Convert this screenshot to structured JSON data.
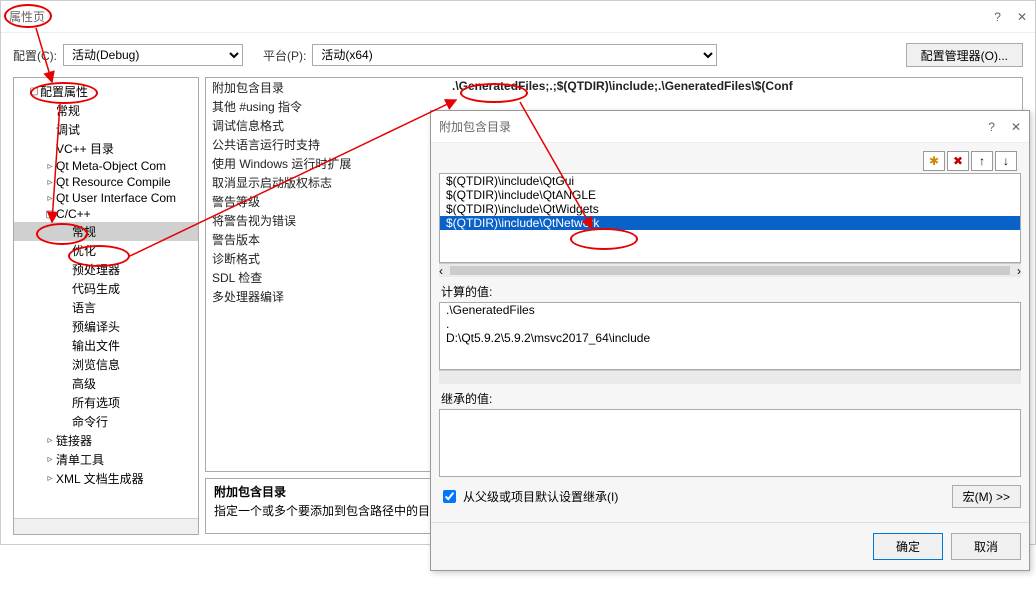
{
  "main": {
    "title": "属性页",
    "help": "?",
    "close": "✕",
    "config_label": "配置(C):",
    "config_value": "活动(Debug)",
    "platform_label": "平台(P):",
    "platform_value": "活动(x64)",
    "config_mgr": "配置管理器(O)..."
  },
  "tree": [
    {
      "label": "配置属性",
      "arrow": "▢",
      "ind": 1
    },
    {
      "label": "常规",
      "arrow": "",
      "ind": 2
    },
    {
      "label": "调试",
      "arrow": "",
      "ind": 2
    },
    {
      "label": "VC++ 目录",
      "arrow": "",
      "ind": 2
    },
    {
      "label": "Qt Meta-Object Com",
      "arrow": "▹",
      "ind": 2
    },
    {
      "label": "Qt Resource Compile",
      "arrow": "▹",
      "ind": 2
    },
    {
      "label": "Qt User Interface Com",
      "arrow": "▹",
      "ind": 2
    },
    {
      "label": "C/C++",
      "arrow": "▢",
      "ind": 2
    },
    {
      "label": "常规",
      "arrow": "",
      "ind": 3,
      "sel": true
    },
    {
      "label": "优化",
      "arrow": "",
      "ind": 3
    },
    {
      "label": "预处理器",
      "arrow": "",
      "ind": 3
    },
    {
      "label": "代码生成",
      "arrow": "",
      "ind": 3
    },
    {
      "label": "语言",
      "arrow": "",
      "ind": 3
    },
    {
      "label": "预编译头",
      "arrow": "",
      "ind": 3
    },
    {
      "label": "输出文件",
      "arrow": "",
      "ind": 3
    },
    {
      "label": "浏览信息",
      "arrow": "",
      "ind": 3
    },
    {
      "label": "高级",
      "arrow": "",
      "ind": 3
    },
    {
      "label": "所有选项",
      "arrow": "",
      "ind": 3
    },
    {
      "label": "命令行",
      "arrow": "",
      "ind": 3
    },
    {
      "label": "链接器",
      "arrow": "▹",
      "ind": 2
    },
    {
      "label": "清单工具",
      "arrow": "▹",
      "ind": 2
    },
    {
      "label": "XML 文档生成器",
      "arrow": "▹",
      "ind": 2
    }
  ],
  "grid": [
    {
      "k": "附加包含目录",
      "v": ".\\GeneratedFiles;.;$(QTDIR)\\include;.\\GeneratedFiles\\$(Conf",
      "hl": true
    },
    {
      "k": "其他 #using 指令",
      "v": ""
    },
    {
      "k": "调试信息格式",
      "v": ""
    },
    {
      "k": "公共语言运行时支持",
      "v": ""
    },
    {
      "k": "使用 Windows 运行时扩展",
      "v": ""
    },
    {
      "k": "取消显示启动版权标志",
      "v": ""
    },
    {
      "k": "警告等级",
      "v": ""
    },
    {
      "k": "将警告视为错误",
      "v": ""
    },
    {
      "k": "警告版本",
      "v": ""
    },
    {
      "k": "诊断格式",
      "v": ""
    },
    {
      "k": "SDL 检查",
      "v": ""
    },
    {
      "k": "多处理器编译",
      "v": ""
    }
  ],
  "desc": {
    "title": "附加包含目录",
    "text": "指定一个或多个要添加到包含路径中的目"
  },
  "dialog": {
    "title": "附加包含目录",
    "help": "?",
    "close": "✕",
    "toolbar": {
      "new": "✱",
      "del": "✖",
      "up": "↑",
      "down": "↓"
    },
    "list": [
      "$(QTDIR)\\include\\QtGui",
      "$(QTDIR)\\include\\QtANGLE",
      "$(QTDIR)\\include\\QtWidgets",
      "$(QTDIR)\\include\\QtNetwork"
    ],
    "list_sel": 3,
    "computed_label": "计算的值:",
    "computed": [
      ".\\GeneratedFiles",
      ".",
      "D:\\Qt5.9.2\\5.9.2\\msvc2017_64\\include"
    ],
    "inherited_label": "继承的值:",
    "inherit_check": "从父级或项目默认设置继承(I)",
    "macro_btn": "宏(M) >>",
    "ok": "确定",
    "cancel": "取消"
  }
}
